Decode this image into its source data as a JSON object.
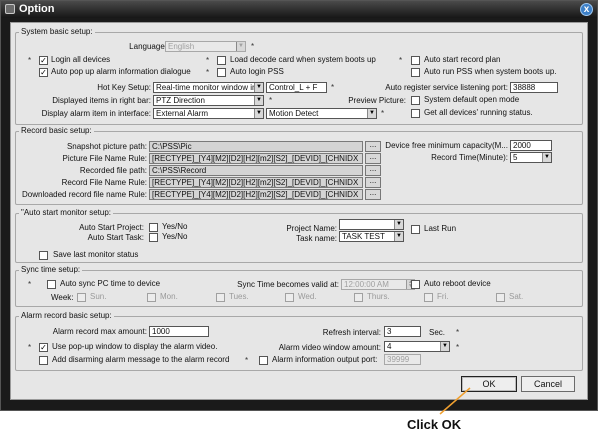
{
  "window": {
    "title": "Option",
    "close_glyph": "x"
  },
  "system_basic": {
    "title": "System basic setup:",
    "language_label": "Language:",
    "language_value": "English",
    "login_all_devices": "Login all devices",
    "load_decode_card": "Load decode card when system boots up",
    "auto_start_record_plan": "Auto start record plan",
    "auto_popup_alarm": "Auto pop up alarm information dialogue",
    "auto_login_pss": "Auto login PSS",
    "auto_run_pss": "Auto run PSS when system boots up.",
    "hotkey_label": "Hot Key Setup:",
    "hotkey_value": "Real-time monitor window in",
    "hotkey_combo": "Control_L + F",
    "auto_register_label": "Auto register service listening port:",
    "auto_register_port": "38888",
    "right_bar_label": "Displayed items in right bar:",
    "right_bar_value": "PTZ Direction",
    "preview_picture_label": "Preview Picture:",
    "system_default_open_mode": "System default open mode",
    "display_alarm_label": "Display alarm item in interface:",
    "display_alarm_value": "External Alarm",
    "display_alarm_value2": "Motion Detect",
    "get_all_devices_status": "Get all devices' running status."
  },
  "record_basic": {
    "title": "Record basic setup:",
    "snapshot_path_label": "Snapshot picture path:",
    "snapshot_path": "C:\\PSS\\Pic",
    "picture_rule_label": "Picture File Name Rule:",
    "picture_rule": "[RECTYPE]_[Y4][M2][D2][H2][m2][S2]_[DEVID]_[CHNIDX",
    "recorded_path_label": "Recorded file  path:",
    "recorded_path": "C:\\PSS\\Record",
    "record_rule_label": "Record File Name Rule:",
    "record_rule": "[RECTYPE]_[Y4][M2][D2][H2][m2][S2]_[DEVID]_[CHNIDX",
    "downloaded_rule_label": "Downloaded record file name Rule:",
    "downloaded_rule": "[RECTYPE]_[Y4][M2][D2][H2][m2][S2]_[DEVID]_[CHNIDX",
    "device_free_capacity_label": "Device free minimum capacity(M...",
    "device_free_capacity": "2000",
    "record_time_label": "Record Time(Minute):",
    "record_time": "5",
    "browse": "..."
  },
  "auto_start_monitor": {
    "title": "\"Auto start monitor setup:",
    "auto_start_project_label": "Auto Start Project:",
    "auto_start_task_label": "Auto Start Task:",
    "yes_no": "Yes/No",
    "project_name_label": "Project Name:",
    "project_name": "",
    "task_name_label": "Task name:",
    "task_name": "TASK TEST",
    "last_run": "Last Run",
    "save_last_monitor_status": "Save last monitor status"
  },
  "sync_time": {
    "title": "Sync time setup:",
    "auto_sync": "Auto sync PC time to device",
    "becomes_valid_label": "Sync Time becomes valid at:",
    "time_value": "12:00:00 AM",
    "auto_reboot": "Auto reboot device",
    "week_label": "Week:",
    "days": [
      "Sun.",
      "Mon.",
      "Tues.",
      "Wed.",
      "Thurs.",
      "Fri.",
      "Sat."
    ]
  },
  "alarm_record": {
    "title": "Alarm record basic setup:",
    "max_amount_label": "Alarm record max amount:",
    "max_amount": "1000",
    "refresh_interval_label": "Refresh interval:",
    "refresh_interval": "3",
    "refresh_unit": "Sec.",
    "use_popup_window": "Use pop-up window to display the alarm video.",
    "video_window_amount_label": "Alarm video window amount:",
    "video_window_amount": "4",
    "add_disarming": "Add disarming alarm message to the alarm record",
    "info_output_port_label": "Alarm information output port:",
    "info_output_port": "39999"
  },
  "buttons": {
    "ok": "OK",
    "cancel": "Cancel"
  },
  "annotation": {
    "text": "Click OK"
  },
  "colors": {
    "annotation_arrow": "#f0a030",
    "title_bar": "#161616",
    "client_bg": "#e6e6e6"
  }
}
